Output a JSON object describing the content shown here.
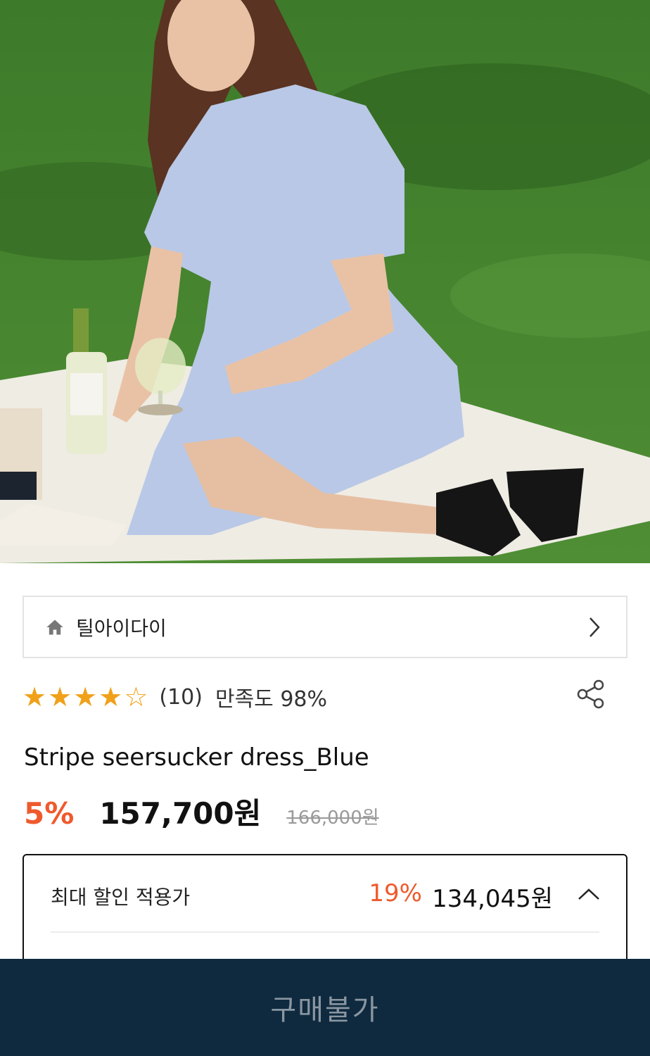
{
  "hero": {
    "image_name": "product-photo"
  },
  "brand": {
    "name": "틸아이다이",
    "icon": "home-icon",
    "chevron": "chevron-right-icon"
  },
  "rating": {
    "stars_filled": 4,
    "stars_total": 5,
    "count_text": "(10)",
    "satisfaction_text": "만족도 98%",
    "share_icon": "share-icon",
    "star_color": "#f0a11a"
  },
  "product": {
    "title": "Stripe seersucker dress_Blue",
    "discount": "5%",
    "price": "157,700원",
    "original_price": "166,000원"
  },
  "max_discount": {
    "label": "최대 할인 적용가",
    "percent": "19%",
    "price": "134,045원",
    "toggle_icon": "chevron-up-icon"
  },
  "buy_button": {
    "label": "구매불가"
  },
  "colors": {
    "accent": "#ef5a2d",
    "bar_bg": "#0f2a3f",
    "bar_text": "#8a96a1"
  }
}
